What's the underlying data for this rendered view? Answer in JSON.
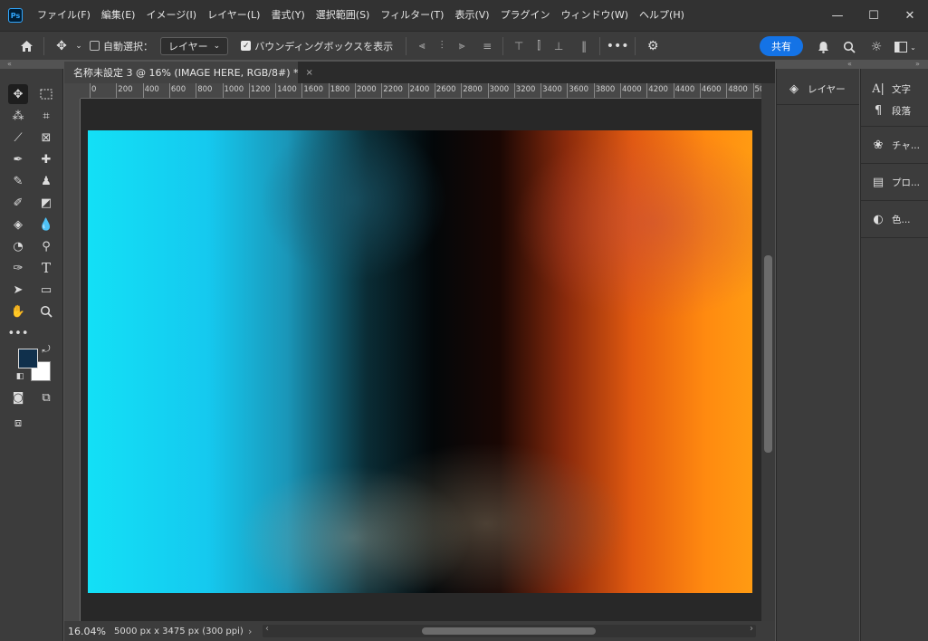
{
  "app": {
    "logo": "Ps"
  },
  "menu": [
    "ファイル(F)",
    "編集(E)",
    "イメージ(I)",
    "レイヤー(L)",
    "書式(Y)",
    "選択範囲(S)",
    "フィルター(T)",
    "表示(V)",
    "プラグイン",
    "ウィンドウ(W)",
    "ヘルプ(H)"
  ],
  "window_controls": {
    "minimize": "—",
    "maximize": "☐",
    "close": "✕"
  },
  "options": {
    "auto_select_label": "自動選択：",
    "auto_select_checked": false,
    "layer_dropdown": "レイヤー",
    "bounding_box_label": "バウンディングボックスを表示",
    "bounding_box_checked": true,
    "more": "•••",
    "share": "共有"
  },
  "document": {
    "tab_title": "名称未設定 3 @ 16% (IMAGE HERE, RGB/8#) *",
    "close": "×",
    "zoom": "16.04%",
    "size": "5000 px x 3475 px (300 ppi)"
  },
  "ruler_ticks": [
    "0",
    "200",
    "400",
    "600",
    "800",
    "1000",
    "1200",
    "1400",
    "1600",
    "1800",
    "2000",
    "2200",
    "2400",
    "2600",
    "2800",
    "3000",
    "3200",
    "3400",
    "3600",
    "3800",
    "4000",
    "4200",
    "4400",
    "4600",
    "4800",
    "50"
  ],
  "colors": {
    "foreground": "#10304c",
    "background": "#ffffff",
    "accent": "#1473e6"
  },
  "panels": {
    "col1": [
      {
        "icon": "layers-icon",
        "label": "レイヤー"
      }
    ],
    "col2": [
      [
        {
          "icon": "character-icon",
          "label": "文字"
        },
        {
          "icon": "paragraph-icon",
          "label": "段落"
        }
      ],
      [
        {
          "icon": "channels-icon",
          "label": "チャ..."
        }
      ],
      [
        {
          "icon": "properties-icon",
          "label": "プロ..."
        }
      ],
      [
        {
          "icon": "color-icon",
          "label": "色..."
        }
      ]
    ]
  }
}
